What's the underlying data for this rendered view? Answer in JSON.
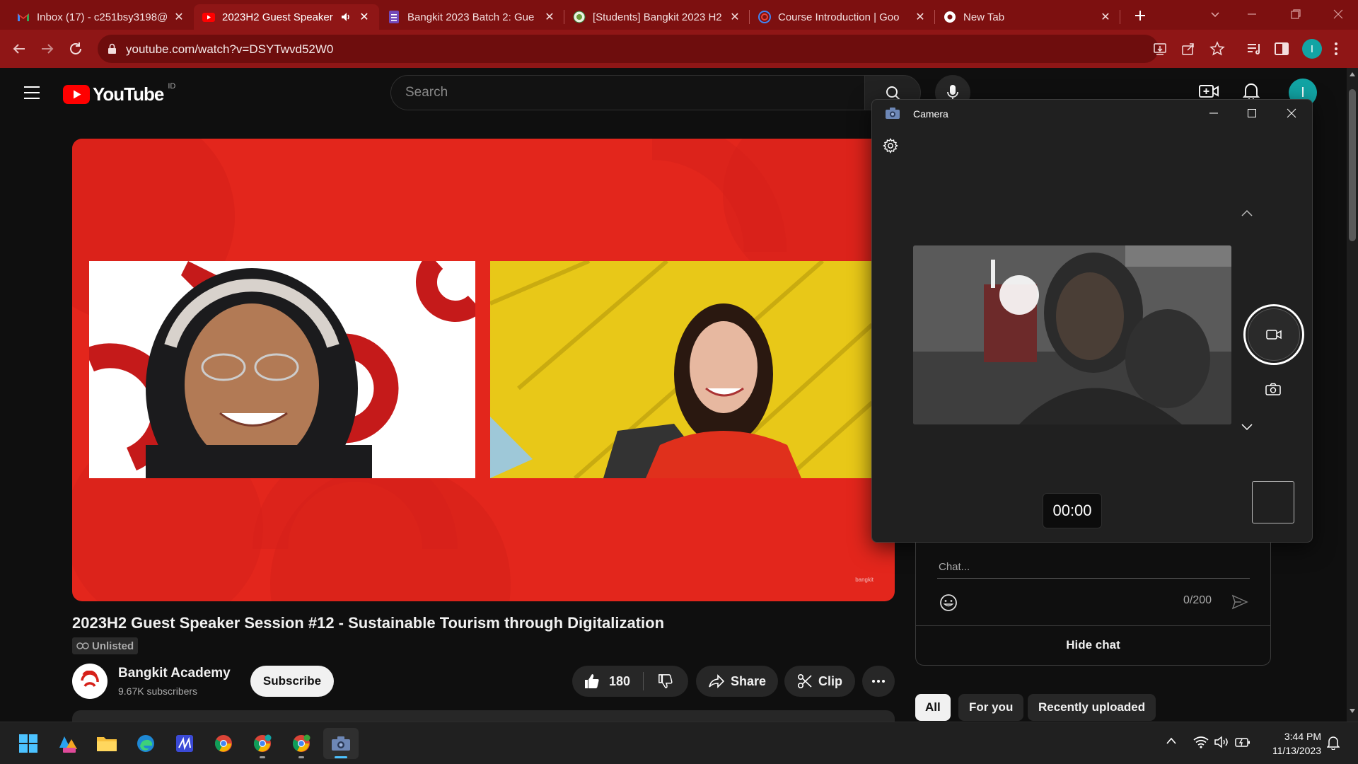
{
  "browser": {
    "tabs": [
      {
        "title": "Inbox (17) - c251bsy3198@",
        "icon": "gmail-icon",
        "active": false
      },
      {
        "title": "2023H2 Guest Speaker",
        "icon": "youtube-icon",
        "active": true,
        "audio": true
      },
      {
        "title": "Bangkit 2023 Batch 2: Gue",
        "icon": "forms-icon",
        "active": false
      },
      {
        "title": "[Students] Bangkit 2023 H2",
        "icon": "sheets-icon",
        "active": false
      },
      {
        "title": "Course Introduction | Goo",
        "icon": "google-icon",
        "active": false
      },
      {
        "title": "New Tab",
        "icon": "chrome-icon",
        "active": false
      }
    ],
    "url": "youtube.com/watch?v=DSYTwvd52W0",
    "profile_initial": "I",
    "accent": "#8f1616"
  },
  "youtube": {
    "logo_text": "YouTube",
    "region": "ID",
    "search_placeholder": "Search",
    "avatar_initial": "I"
  },
  "video": {
    "title": "2023H2 Guest Speaker Session #12 - Sustainable Tourism through Digitalization",
    "badge": "Unlisted",
    "channel": {
      "name": "Bangkit Academy",
      "subscribers": "9.67K subscribers"
    },
    "subscribe_label": "Subscribe",
    "likes": "180",
    "share_label": "Share",
    "clip_label": "Clip",
    "slide_brand": "bangkit"
  },
  "camera_app": {
    "title": "Camera",
    "timer": "00:00"
  },
  "chat": {
    "placeholder": "Chat...",
    "counter": "0/200",
    "hide_label": "Hide chat"
  },
  "chips": [
    "All",
    "For you",
    "Recently uploaded"
  ],
  "taskbar": {
    "time": "3:44 PM",
    "date": "11/13/2023"
  }
}
